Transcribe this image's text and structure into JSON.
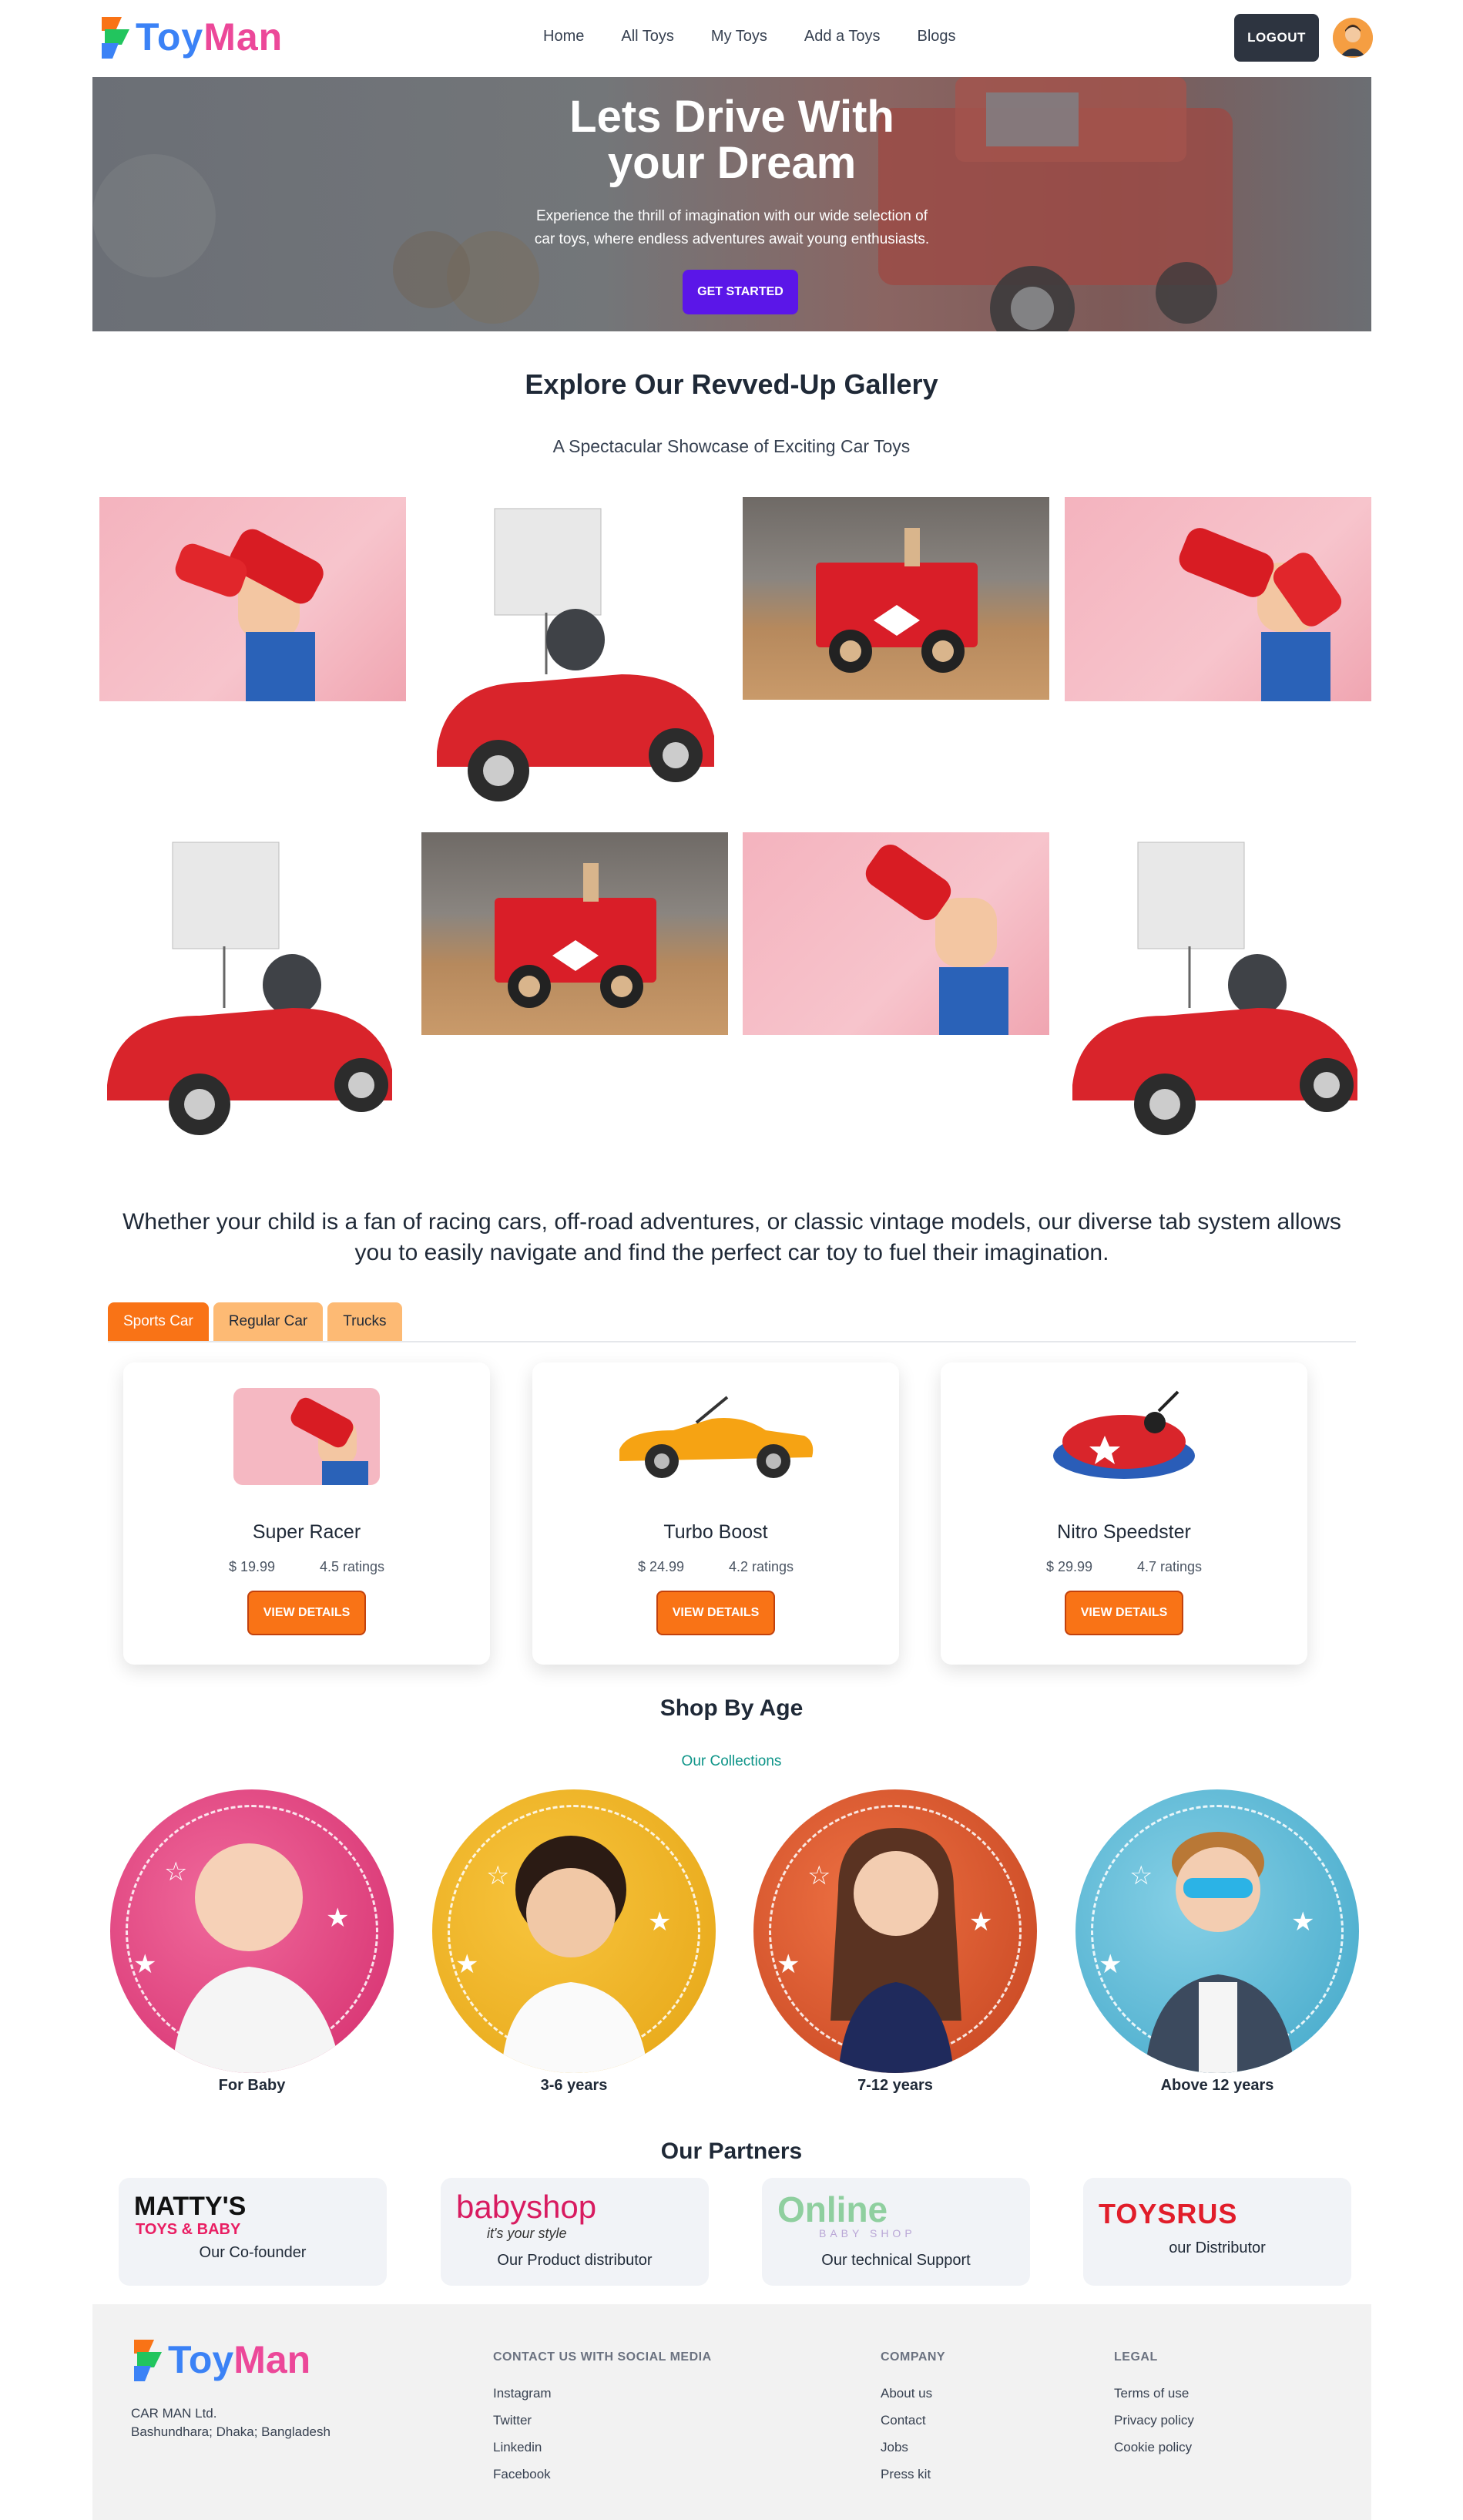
{
  "brand": {
    "name_part1": "Toy",
    "name_part2": "Man"
  },
  "nav": {
    "links": [
      "Home",
      "All Toys",
      "My Toys",
      "Add a Toys",
      "Blogs"
    ],
    "logout_label": "LOGOUT"
  },
  "hero": {
    "title_line1": "Lets Drive With",
    "title_line2": "your Dream",
    "subtitle_line1": "Experience the thrill of imagination with our wide selection of",
    "subtitle_line2": "car toys, where endless adventures await young enthusiasts.",
    "cta_label": "GET STARTED"
  },
  "gallery": {
    "title": "Explore Our Revved-Up Gallery",
    "subtitle": "A Spectacular Showcase of Exciting Car Toys"
  },
  "intro": {
    "text": "Whether your child is a fan of racing cars, off-road adventures, or classic vintage models, our diverse tab system allows you to easily navigate and find the perfect car toy to fuel their imagination."
  },
  "tabs": [
    "Sports Car",
    "Regular Car",
    "Trucks"
  ],
  "products": [
    {
      "name": "Super Racer",
      "price": "$ 19.99",
      "rating": "4.5 ratings",
      "button": "VIEW DETAILS"
    },
    {
      "name": "Turbo Boost",
      "price": "$ 24.99",
      "rating": "4.2 ratings",
      "button": "VIEW DETAILS"
    },
    {
      "name": "Nitro Speedster",
      "price": "$ 29.99",
      "rating": "4.7 ratings",
      "button": "VIEW DETAILS"
    }
  ],
  "age_section": {
    "title": "Shop By Age",
    "subtitle": "Our Collections",
    "groups": [
      {
        "label": "For Baby",
        "color": "#e23e7b"
      },
      {
        "label": "3-6 years",
        "color": "#f2b21d"
      },
      {
        "label": "7-12 years",
        "color": "#d9512b"
      },
      {
        "label": "Above 12 years",
        "color": "#5bb8d6"
      }
    ]
  },
  "partners": {
    "title": "Our Partners",
    "items": [
      {
        "logo": "MATTY'S",
        "logo_sub": "TOYS & BABY",
        "caption": "Our Co-founder"
      },
      {
        "logo": "babyshop",
        "logo_sub": "it's your style",
        "caption": "Our Product distributor"
      },
      {
        "logo": "Online",
        "logo_sub": "BABY SHOP",
        "caption": "Our technical Support"
      },
      {
        "logo": "TOYSRUS",
        "logo_sub": "",
        "caption": "our Distributor"
      }
    ]
  },
  "footer": {
    "company_name": "CAR MAN Ltd.",
    "address": "Bashundhara; Dhaka; Bangladesh",
    "social_heading": "CONTACT US WITH SOCIAL MEDIA",
    "social_links": [
      "Instagram",
      "Twitter",
      "Linkedin",
      "Facebook"
    ],
    "company_heading": "COMPANY",
    "company_links": [
      "About us",
      "Contact",
      "Jobs",
      "Press kit"
    ],
    "legal_heading": "LEGAL",
    "legal_links": [
      "Terms of use",
      "Privacy policy",
      "Cookie policy"
    ]
  },
  "colors": {
    "brand_pink": "#ec4899",
    "brand_blue": "#3b82f6",
    "hero_cta": "#5b16e8",
    "accent_orange": "#f97316",
    "tab_inactive": "#fdba74",
    "logout_bg": "#2d3440",
    "collections_teal": "#0d9488"
  }
}
